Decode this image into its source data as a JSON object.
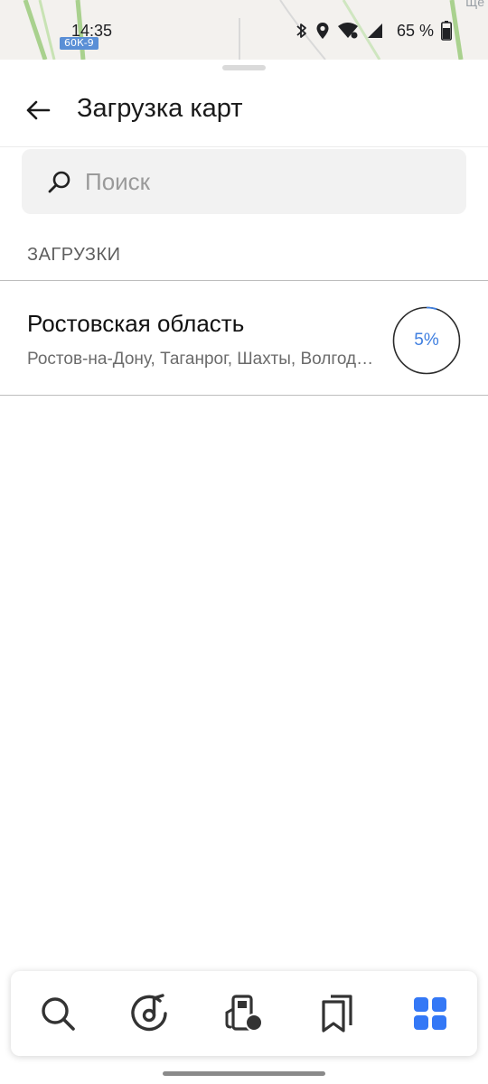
{
  "status_bar": {
    "time": "14:35",
    "battery": "65 %"
  },
  "map": {
    "road_label": "60К-9",
    "corner_text": "Ще"
  },
  "header": {
    "title": "Загрузка карт"
  },
  "search": {
    "placeholder": "Поиск"
  },
  "section": {
    "title": "ЗАГРУЗКИ"
  },
  "downloads": [
    {
      "title": "Ростовская область",
      "subtitle": "Ростов-на-Дону, Таганрог, Шахты, Волгодонск",
      "progress": "5%",
      "progress_value": 0.05
    }
  ],
  "colors": {
    "accent": "#3f7fe0",
    "tab_active": "#3478f6",
    "icon": "#333333"
  },
  "tabs": [
    {
      "icon": "search-icon"
    },
    {
      "icon": "music-icon"
    },
    {
      "icon": "fuel-icon"
    },
    {
      "icon": "bookmarks-icon"
    },
    {
      "icon": "services-grid-icon",
      "active": true
    }
  ]
}
